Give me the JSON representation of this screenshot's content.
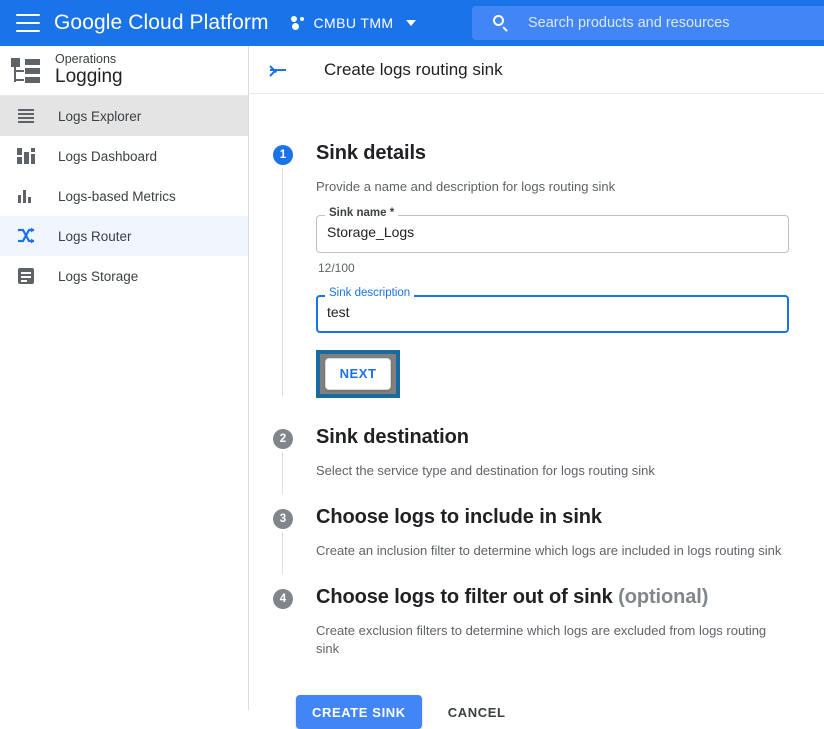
{
  "topbar": {
    "menu_icon": "hamburger-icon",
    "brand": "Google Cloud Platform",
    "project_icon": "project-dots-icon",
    "project_name": "CMBU TMM",
    "project_chevron": "chevron-down-icon",
    "search_icon": "search-icon",
    "search_placeholder": "Search products and resources",
    "search_value": ""
  },
  "sidebar": {
    "product_icon": "operations-tree-icon",
    "product_group": "Operations",
    "product_name": "Logging",
    "items": [
      {
        "label": "Logs Explorer",
        "icon": "list-lines-icon",
        "state": "hover"
      },
      {
        "label": "Logs Dashboard",
        "icon": "dashboard-icon",
        "state": "default"
      },
      {
        "label": "Logs-based Metrics",
        "icon": "bar-chart-icon",
        "state": "default"
      },
      {
        "label": "Logs Router",
        "icon": "router-shuffle-icon",
        "state": "selected"
      },
      {
        "label": "Logs Storage",
        "icon": "storage-doc-icon",
        "state": "default"
      }
    ]
  },
  "page": {
    "back_icon": "back-arrow-icon",
    "title": "Create logs routing sink"
  },
  "steps": [
    {
      "number": "1",
      "title": "Sink details",
      "optional_suffix": "",
      "description": "Provide a name and description for logs routing sink"
    },
    {
      "number": "2",
      "title": "Sink destination",
      "optional_suffix": "",
      "description": "Select the service type and destination for logs routing sink"
    },
    {
      "number": "3",
      "title": "Choose logs to include in sink",
      "optional_suffix": "",
      "description": "Create an inclusion filter to determine which logs are included in logs routing sink"
    },
    {
      "number": "4",
      "title": "Choose logs to filter out of sink",
      "optional_suffix": "(optional)",
      "description": "Create exclusion filters to determine which logs are excluded from logs routing sink"
    }
  ],
  "form": {
    "sink_name": {
      "label": "Sink name *",
      "value": "Storage_Logs",
      "placeholder": "",
      "counter": "12/100"
    },
    "sink_description": {
      "label": "Sink description",
      "value": "test",
      "placeholder": ""
    },
    "next_label": "NEXT"
  },
  "actions": {
    "create_label": "CREATE SINK",
    "cancel_label": "CANCEL"
  },
  "colors": {
    "brand_blue": "#1a73e8",
    "header_blue": "#1a73e8",
    "search_blue": "#4285f4",
    "primary_button": "#4285f4",
    "annotation_highlight": "#1a6aa0",
    "step_idle": "#80868b",
    "selected_nav": "#f1f6fe"
  }
}
